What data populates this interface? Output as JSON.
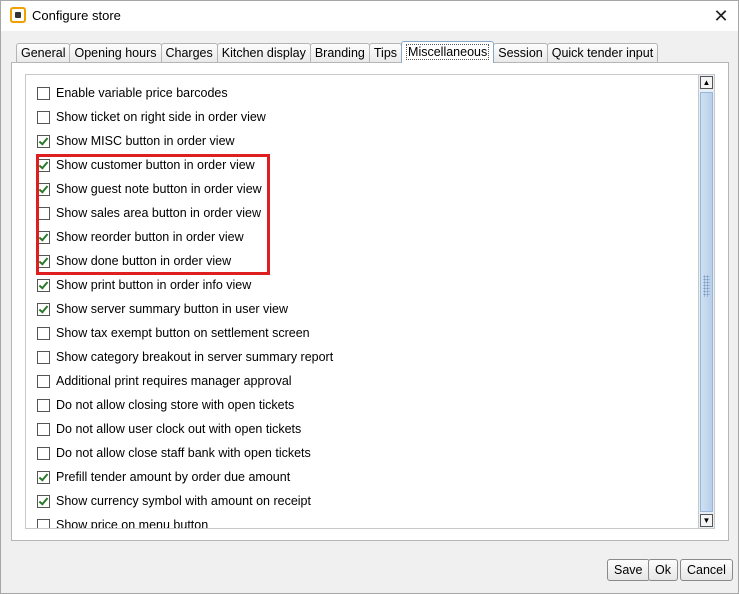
{
  "window": {
    "title": "Configure store"
  },
  "tabs": [
    {
      "label": "General"
    },
    {
      "label": "Opening hours"
    },
    {
      "label": "Charges"
    },
    {
      "label": "Kitchen display"
    },
    {
      "label": "Branding"
    },
    {
      "label": "Tips"
    },
    {
      "label": "Miscellaneous",
      "selected": true
    },
    {
      "label": "Session"
    },
    {
      "label": "Quick tender input"
    }
  ],
  "options": [
    {
      "label": "Enable variable price barcodes",
      "checked": false
    },
    {
      "label": "Show ticket on right side in order view",
      "checked": false
    },
    {
      "label": "Show MISC button in order view",
      "checked": true
    },
    {
      "label": "Show customer button in order view",
      "checked": true
    },
    {
      "label": "Show guest note button in order view",
      "checked": true
    },
    {
      "label": "Show sales area button in order view",
      "checked": false
    },
    {
      "label": "Show reorder button in order view",
      "checked": true
    },
    {
      "label": "Show done button in order view",
      "checked": true
    },
    {
      "label": "Show print button in order info view",
      "checked": true
    },
    {
      "label": "Show server summary button in user view",
      "checked": true
    },
    {
      "label": "Show tax exempt button on settlement screen",
      "checked": false
    },
    {
      "label": "Show category breakout in server summary report",
      "checked": false
    },
    {
      "label": "Additional print requires manager approval",
      "checked": false
    },
    {
      "label": "Do not allow closing store with open tickets",
      "checked": false
    },
    {
      "label": "Do not allow user clock out with open tickets",
      "checked": false
    },
    {
      "label": "Do not allow close staff bank with open tickets",
      "checked": false
    },
    {
      "label": "Prefill tender amount by order due amount",
      "checked": true
    },
    {
      "label": "Show currency symbol with amount on receipt",
      "checked": true
    },
    {
      "label": "Show price on menu button",
      "checked": false
    }
  ],
  "colors": {
    "highlight": "#dd1f1f",
    "check": "#2a7a2a"
  },
  "buttons": {
    "save": "Save",
    "ok": "Ok",
    "cancel": "Cancel"
  },
  "icons": {
    "close": "close-icon",
    "app": "app-icon",
    "scroll_up": "arrow-up-icon",
    "scroll_down": "arrow-down-icon"
  }
}
